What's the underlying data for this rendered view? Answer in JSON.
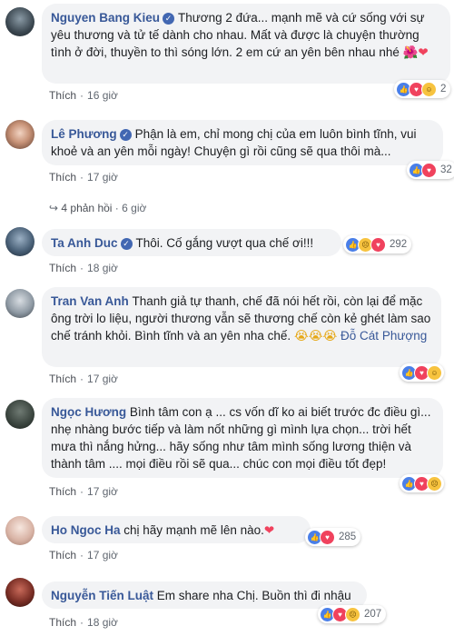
{
  "comments": [
    {
      "name": "Nguyen Bang Kieu",
      "verified": true,
      "text": "Thương 2 đứa... mạnh mẽ và cứ sống với sự yêu thương và tử tế dành cho nhau. Mất và được là chuyện thường tình ở đời, thuyền to thì sóng lớn. 2 em cứ an yên bên nhau nhé",
      "emoji": "🌺❤",
      "like_label": "Thích",
      "time": "16 giờ",
      "reactions": [
        "like",
        "love",
        "haha"
      ],
      "reaction_count": "2"
    },
    {
      "name": "Lê Phương",
      "verified": true,
      "text": "Phận là em, chỉ mong chị của em luôn bình tĩnh, vui khoẻ và an yên mỗi ngày! Chuyện gì rồi cũng sẽ qua thôi mà...",
      "like_label": "Thích",
      "time": "17 giờ",
      "reactions": [
        "like",
        "love"
      ],
      "reaction_count": "32",
      "replies_label": "4 phản hồi",
      "replies_time": "6 giờ"
    },
    {
      "name": "Ta Anh Duc",
      "verified": true,
      "text": "Thôi. Cố gắng vượt qua chế ơi!!!",
      "like_label": "Thích",
      "time": "18 giờ",
      "reactions": [
        "like",
        "sad",
        "love"
      ],
      "reaction_count": "292"
    },
    {
      "name": "Tran Van Anh",
      "verified": false,
      "text": "Thanh giả tự thanh, chế đã nói hết rồi, còn lại để mặc ông trời lo liệu, người thương vẫn sẽ thương chế còn kẻ ghét làm sao chế tránh khỏi. Bình tĩnh và an yên nha chế.",
      "emoji": "😭😭😭",
      "tag": "Đỗ Cát Phượng",
      "like_label": "Thích",
      "time": "17 giờ",
      "reactions": [
        "like",
        "love",
        "haha"
      ],
      "reaction_count": ""
    },
    {
      "name": "Ngọc Hương",
      "verified": false,
      "text": "Bình tâm con ạ ... cs vốn dĩ ko ai biết trước đc điều gì... nhẹ nhàng bước tiếp và làm nốt những gì mình lựa chọn... trời hết mưa thì nắng hửng... hãy sống như tâm mình sống lương thiện và thành tâm .... mọi điều rồi sẽ qua... chúc con mọi điều tốt đẹp!",
      "like_label": "Thích",
      "time": "17 giờ",
      "reactions": [
        "like",
        "love",
        "sad"
      ],
      "reaction_count": ""
    },
    {
      "name": "Ho Ngoc Ha",
      "verified": false,
      "text": "chị hãy mạnh mẽ lên nào.",
      "emoji": "❤",
      "like_label": "Thích",
      "time": "17 giờ",
      "reactions": [
        "like",
        "love"
      ],
      "reaction_count": "285"
    },
    {
      "name": "Nguyễn Tiến Luật",
      "verified": false,
      "text": "Em share nha Chị. Buồn thì đi nhậu",
      "like_label": "Thích",
      "time": "18 giờ",
      "reactions": [
        "like",
        "love",
        "sad"
      ],
      "reaction_count": "207"
    }
  ],
  "colors": {
    "name": "#385898",
    "bubble": "#f2f3f5",
    "meta": "#606770"
  }
}
